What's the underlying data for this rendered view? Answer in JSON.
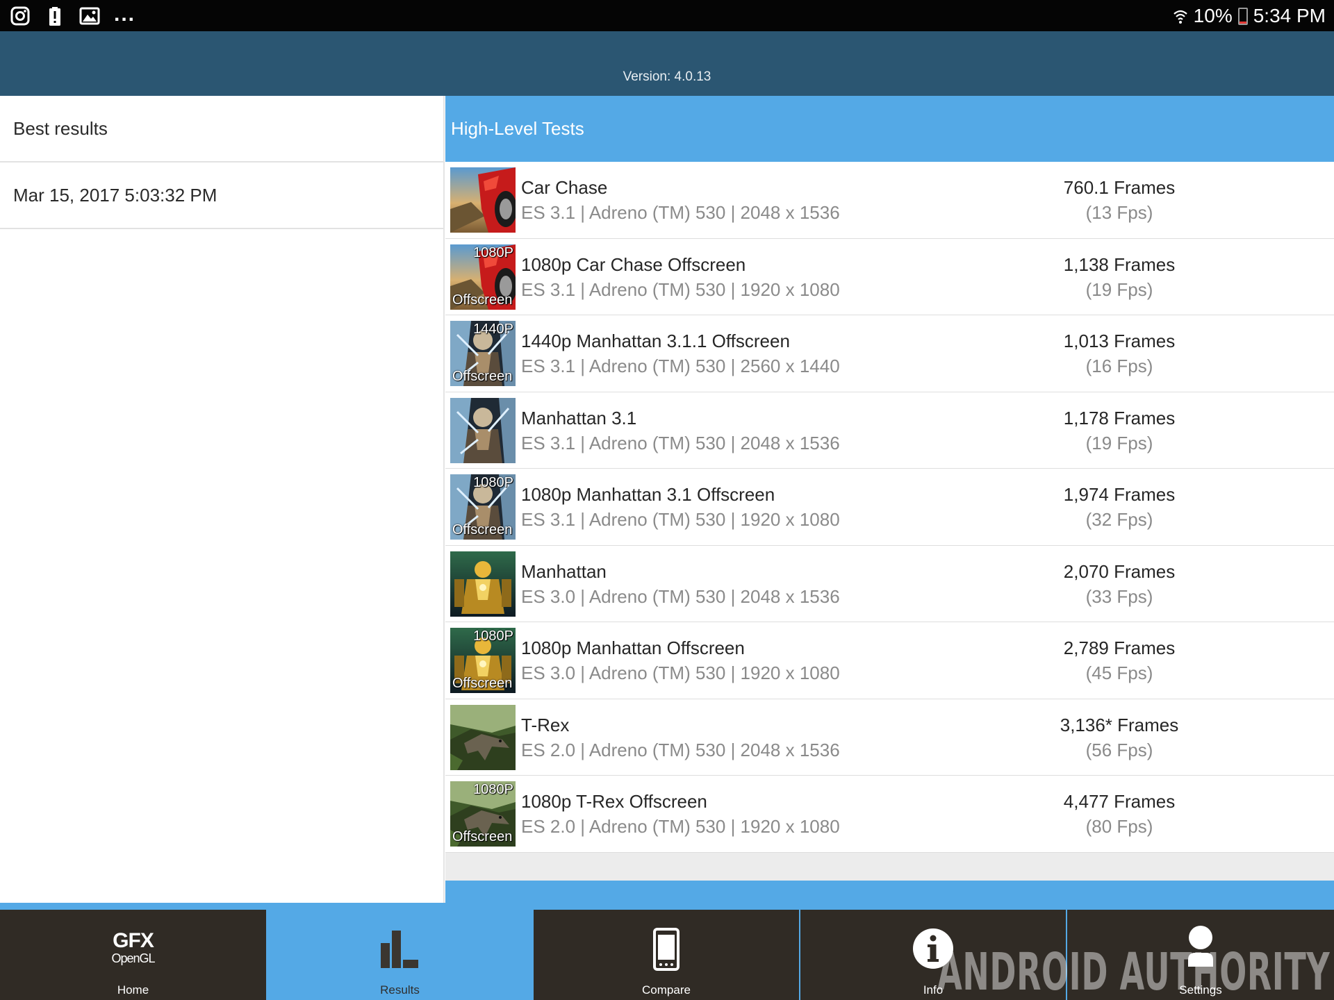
{
  "status_bar": {
    "notification_icons": [
      "instagram-icon",
      "battery-alert-icon",
      "image-icon"
    ],
    "overflow_dots": "...",
    "battery_percent": "10%",
    "battery_level": 0.1,
    "time": "5:34 PM"
  },
  "header": {
    "version": "Version: 4.0.13"
  },
  "left_pane": {
    "rows": [
      {
        "label": "Best results"
      },
      {
        "label": "Mar 15, 2017 5:03:32 PM"
      }
    ]
  },
  "right_pane": {
    "section_title": "High-Level Tests",
    "tests": [
      {
        "name": "Car Chase",
        "spec": "ES 3.1 | Adreno (TM) 530 | 2048 x 1536",
        "frames": "760.1 Frames",
        "fps": "(13 Fps)",
        "thumb": "car-chase",
        "tag": "",
        "tag_sub": ""
      },
      {
        "name": "1080p Car Chase Offscreen",
        "spec": "ES 3.1 | Adreno (TM) 530 | 1920 x 1080",
        "frames": "1,138 Frames",
        "fps": "(19 Fps)",
        "thumb": "car-chase",
        "tag": "1080P",
        "tag_sub": "Offscreen"
      },
      {
        "name": "1440p Manhattan 3.1.1 Offscreen",
        "spec": "ES 3.1 | Adreno (TM) 530 | 2560 x 1440",
        "frames": "1,013 Frames",
        "fps": "(16 Fps)",
        "thumb": "manhattan31",
        "tag": "1440P",
        "tag_sub": "Offscreen"
      },
      {
        "name": "Manhattan 3.1",
        "spec": "ES 3.1 | Adreno (TM) 530 | 2048 x 1536",
        "frames": "1,178 Frames",
        "fps": "(19 Fps)",
        "thumb": "manhattan31",
        "tag": "",
        "tag_sub": ""
      },
      {
        "name": "1080p Manhattan 3.1 Offscreen",
        "spec": "ES 3.1 | Adreno (TM) 530 | 1920 x 1080",
        "frames": "1,974 Frames",
        "fps": "(32 Fps)",
        "thumb": "manhattan31",
        "tag": "1080P",
        "tag_sub": "Offscreen"
      },
      {
        "name": "Manhattan",
        "spec": "ES 3.0 | Adreno (TM) 530 | 2048 x 1536",
        "frames": "2,070 Frames",
        "fps": "(33 Fps)",
        "thumb": "manhattan",
        "tag": "",
        "tag_sub": ""
      },
      {
        "name": "1080p Manhattan Offscreen",
        "spec": "ES 3.0 | Adreno (TM) 530 | 1920 x 1080",
        "frames": "2,789 Frames",
        "fps": "(45 Fps)",
        "thumb": "manhattan",
        "tag": "1080P",
        "tag_sub": "Offscreen"
      },
      {
        "name": "T-Rex",
        "spec": "ES 2.0 | Adreno (TM) 530 | 2048 x 1536",
        "frames": "3,136* Frames",
        "fps": "(56 Fps)",
        "thumb": "trex",
        "tag": "",
        "tag_sub": ""
      },
      {
        "name": "1080p T-Rex Offscreen",
        "spec": "ES 2.0 | Adreno (TM) 530 | 1920 x 1080",
        "frames": "4,477 Frames",
        "fps": "(80 Fps)",
        "thumb": "trex",
        "tag": "1080P",
        "tag_sub": "Offscreen"
      }
    ]
  },
  "bottom_nav": {
    "logo_line1": "GFX",
    "logo_line2": "OpenGL",
    "items": [
      {
        "label": "Home",
        "icon": "gfx-logo-icon",
        "active": false
      },
      {
        "label": "Results",
        "icon": "bar-chart-icon",
        "active": true
      },
      {
        "label": "Compare",
        "icon": "phone-icon",
        "active": false
      },
      {
        "label": "Info",
        "icon": "info-icon",
        "active": false
      },
      {
        "label": "Settings",
        "icon": "person-icon",
        "active": false
      }
    ]
  },
  "watermark": "ANDROID AUTHORITY",
  "colors": {
    "status_bar": "#050505",
    "header": "#2b5672",
    "accent_blue": "#54a9e6",
    "nav_dark": "#302b25",
    "battery_low": "#e53935"
  }
}
